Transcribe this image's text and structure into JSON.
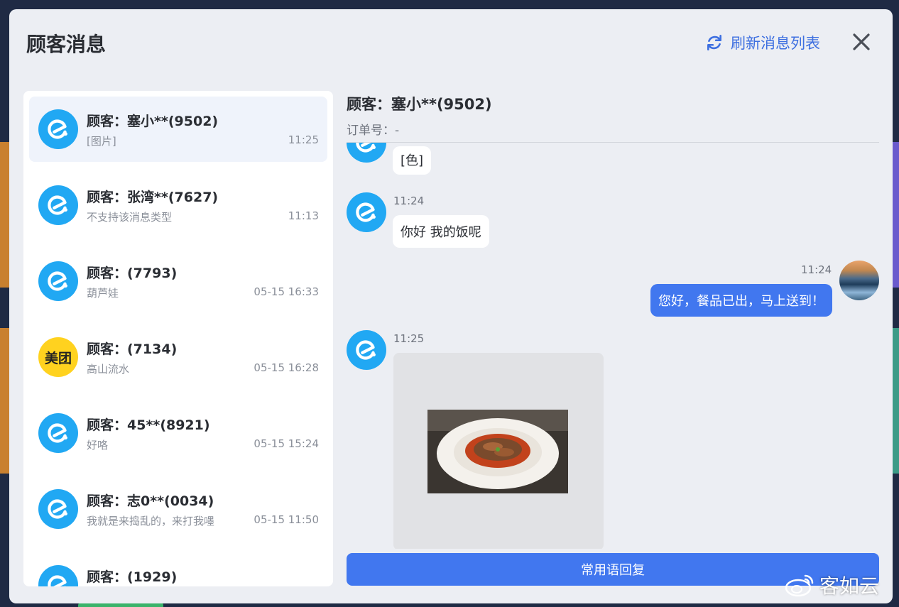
{
  "modal": {
    "title": "顾客消息",
    "refresh_label": "刷新消息列表"
  },
  "conversations": [
    {
      "name": "顾客：塞小**(9502)",
      "last_message": "[图片]",
      "time": "11:25",
      "source": "eleme",
      "active": true
    },
    {
      "name": "顾客：张湾**(7627)",
      "last_message": "不支持该消息类型",
      "time": "11:13",
      "source": "eleme"
    },
    {
      "name": "顾客：(7793)",
      "last_message": "葫芦娃",
      "time": "05-15 16:33",
      "source": "eleme"
    },
    {
      "name": "顾客：(7134)",
      "last_message": "高山流水",
      "time": "05-15 16:28",
      "source": "meituan",
      "source_label": "美团"
    },
    {
      "name": "顾客：45**(8921)",
      "last_message": "好咯",
      "time": "05-15 15:24",
      "source": "eleme"
    },
    {
      "name": "顾客：志0**(0034)",
      "last_message": "我就是来捣乱的，来打我嚜",
      "time": "05-15 11:50",
      "source": "eleme"
    },
    {
      "name": "顾客：(1929)",
      "last_message": "",
      "time": "",
      "source": "eleme"
    }
  ],
  "chat": {
    "customer_name": "顾客：塞小**(9502)",
    "order_label": "订单号：-",
    "messages": [
      {
        "direction": "in",
        "type": "text",
        "time": "",
        "text": "[色]"
      },
      {
        "direction": "in",
        "type": "text",
        "time": "11:24",
        "text": "你好 我的饭呢"
      },
      {
        "direction": "out",
        "type": "text",
        "time": "11:24",
        "text": "您好，餐品已出，马上送到！"
      },
      {
        "direction": "in",
        "type": "image",
        "time": "11:25"
      }
    ],
    "quick_reply_label": "常用语回复"
  },
  "watermark": "客如云",
  "colors": {
    "accent": "#4177ef",
    "eleme_blue": "#21a8f3",
    "meituan_yellow": "#ffd21f"
  }
}
